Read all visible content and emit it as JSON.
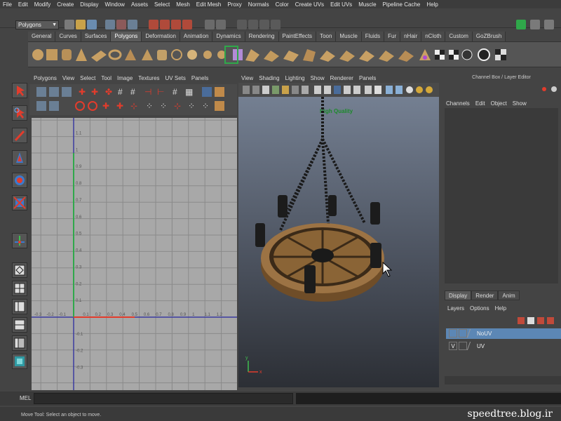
{
  "menubar": [
    "File",
    "Edit",
    "Modify",
    "Create",
    "Display",
    "Window",
    "Assets",
    "Select",
    "Mesh",
    "Edit Mesh",
    "Proxy",
    "Normals",
    "Color",
    "Create UVs",
    "Edit UVs",
    "Muscle",
    "Pipeline Cache",
    "Help"
  ],
  "mode_selector": {
    "value": "Polygons"
  },
  "shelf_tabs": [
    "General",
    "Curves",
    "Surfaces",
    "Polygons",
    "Deformation",
    "Animation",
    "Dynamics",
    "Rendering",
    "PaintEffects",
    "Toon",
    "Muscle",
    "Fluids",
    "Fur",
    "nHair",
    "nCloth",
    "Custom",
    "GoZBrush"
  ],
  "active_shelf_tab": "Polygons",
  "uv_editor": {
    "menu": [
      "Polygons",
      "View",
      "Select",
      "Tool",
      "Image",
      "Textures",
      "UV Sets",
      "Panels"
    ],
    "axis_labels_x": [
      "-0.3",
      "-0.2",
      "-0.1",
      "0.1",
      "0.2",
      "0.3",
      "0.4",
      "0.5",
      "0.6",
      "0.7",
      "0.8",
      "0.9",
      "1",
      "1.1",
      "1.2"
    ],
    "axis_labels_y": [
      "1.1",
      "1",
      "0.9",
      "0.8",
      "0.7",
      "0.6",
      "0.5",
      "0.4",
      "0.3",
      "0.2",
      "0.1",
      "-0.1",
      "-0.2",
      "-0.3"
    ]
  },
  "viewport": {
    "menu": [
      "View",
      "Shading",
      "Lighting",
      "Show",
      "Renderer",
      "Panels"
    ],
    "quality_label": "High Quality",
    "axis_labels": {
      "x": "x",
      "y": "y"
    }
  },
  "channel_box": {
    "title": "Channel Box / Layer Editor",
    "menu": [
      "Channels",
      "Edit",
      "Object",
      "Show"
    ],
    "layer_tabs": [
      "Display",
      "Render",
      "Anim"
    ],
    "active_layer_tab": "Display",
    "layer_menu": [
      "Layers",
      "Options",
      "Help"
    ],
    "layers": [
      {
        "name": "NoUV",
        "visible": "",
        "selected": true
      },
      {
        "name": "UV",
        "visible": "V",
        "selected": false
      }
    ]
  },
  "mel": {
    "label": "MEL"
  },
  "helpline": {
    "text": "Move Tool: Select an object to move."
  },
  "watermark": "speedtree.blog.ir",
  "colors": {
    "accent_green": "#2fa84a",
    "selection_blue": "#5c87b5",
    "wood": "#8a6436"
  }
}
